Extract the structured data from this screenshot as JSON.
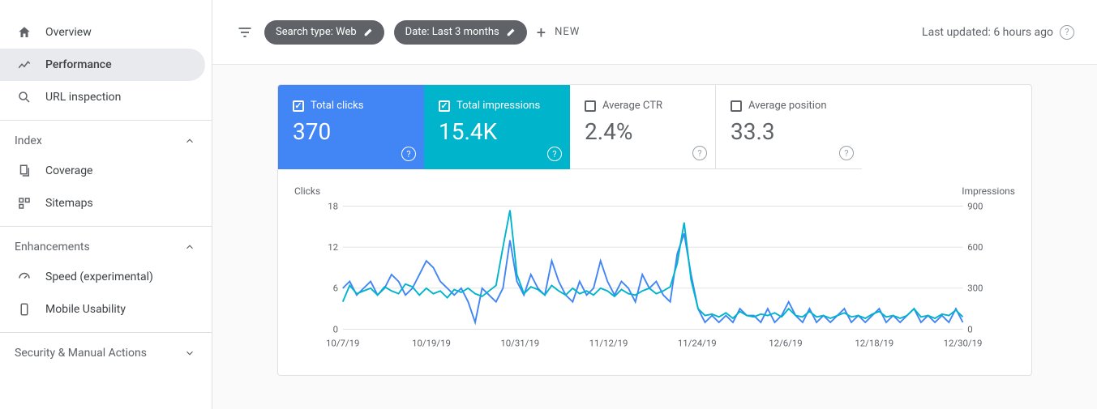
{
  "sidebar": {
    "items": [
      {
        "icon": "home",
        "label": "Overview"
      },
      {
        "icon": "trend",
        "label": "Performance",
        "active": true
      },
      {
        "icon": "search",
        "label": "URL inspection"
      }
    ],
    "sections": [
      {
        "title": "Index",
        "open": true,
        "items": [
          {
            "icon": "pages",
            "label": "Coverage"
          },
          {
            "icon": "sitemap",
            "label": "Sitemaps"
          }
        ]
      },
      {
        "title": "Enhancements",
        "open": true,
        "items": [
          {
            "icon": "speed",
            "label": "Speed (experimental)"
          },
          {
            "icon": "phone",
            "label": "Mobile Usability"
          }
        ]
      },
      {
        "title": "Security & Manual Actions",
        "open": false,
        "items": []
      }
    ]
  },
  "filters": {
    "search_type": "Search type: Web",
    "date": "Date: Last 3 months",
    "new_label": "NEW"
  },
  "last_updated": "Last updated: 6 hours ago",
  "metrics": {
    "clicks": {
      "label": "Total clicks",
      "value": "370",
      "selected": true
    },
    "impressions": {
      "label": "Total impressions",
      "value": "15.4K",
      "selected": true
    },
    "ctr": {
      "label": "Average CTR",
      "value": "2.4%",
      "selected": false
    },
    "position": {
      "label": "Average position",
      "value": "33.3",
      "selected": false
    }
  },
  "chart": {
    "left_axis_label": "Clicks",
    "right_axis_label": "Impressions",
    "left_ticks": [
      "18",
      "12",
      "6",
      "0"
    ],
    "right_ticks": [
      "900",
      "600",
      "300",
      "0"
    ],
    "x_labels": [
      "10/7/19",
      "10/19/19",
      "10/31/19",
      "11/12/19",
      "11/24/19",
      "12/6/19",
      "12/18/19",
      "12/30/19"
    ]
  },
  "chart_data": {
    "type": "line",
    "xlabel": "",
    "left_ylabel": "Clicks",
    "right_ylabel": "Impressions",
    "left_ylim": [
      0,
      18
    ],
    "right_ylim": [
      0,
      900
    ],
    "x_tick_labels": [
      "10/7/19",
      "10/19/19",
      "10/31/19",
      "11/12/19",
      "11/24/19",
      "12/6/19",
      "12/18/19",
      "12/30/19"
    ],
    "series": [
      {
        "name": "Clicks",
        "axis": "left",
        "color": "#4285f4",
        "values": [
          6,
          7,
          5,
          6,
          7,
          5,
          6,
          8,
          7,
          5,
          6,
          8,
          10,
          9,
          7,
          6,
          5,
          6,
          4,
          1,
          6,
          5,
          4,
          6,
          13,
          7,
          5,
          8,
          6,
          5,
          10,
          7,
          5,
          4,
          7,
          5,
          6,
          10,
          7,
          5,
          7,
          6,
          4,
          8,
          6,
          7,
          5,
          4,
          11,
          14,
          8,
          3,
          1,
          2,
          1,
          2,
          1,
          3,
          2,
          2,
          1,
          3,
          1,
          2,
          4,
          2,
          1,
          3,
          1,
          2,
          1,
          2,
          3,
          1,
          2,
          1,
          2,
          3,
          1,
          2,
          1,
          2,
          3,
          1,
          2,
          1,
          2,
          1,
          3,
          1
        ]
      },
      {
        "name": "Impressions",
        "axis": "right",
        "color": "#00b5cb",
        "values": [
          200,
          320,
          260,
          280,
          300,
          250,
          310,
          280,
          260,
          330,
          310,
          250,
          300,
          260,
          280,
          230,
          290,
          270,
          300,
          260,
          240,
          280,
          320,
          600,
          870,
          400,
          260,
          310,
          290,
          250,
          320,
          280,
          250,
          300,
          260,
          280,
          250,
          300,
          280,
          240,
          290,
          260,
          250,
          280,
          300,
          260,
          280,
          310,
          480,
          780,
          360,
          150,
          100,
          110,
          90,
          120,
          80,
          130,
          100,
          90,
          110,
          100,
          120,
          90,
          150,
          100,
          90,
          130,
          90,
          100,
          80,
          100,
          120,
          90,
          100,
          80,
          110,
          130,
          90,
          100,
          80,
          100,
          150,
          90,
          100,
          80,
          110,
          100,
          140,
          90
        ]
      }
    ]
  }
}
